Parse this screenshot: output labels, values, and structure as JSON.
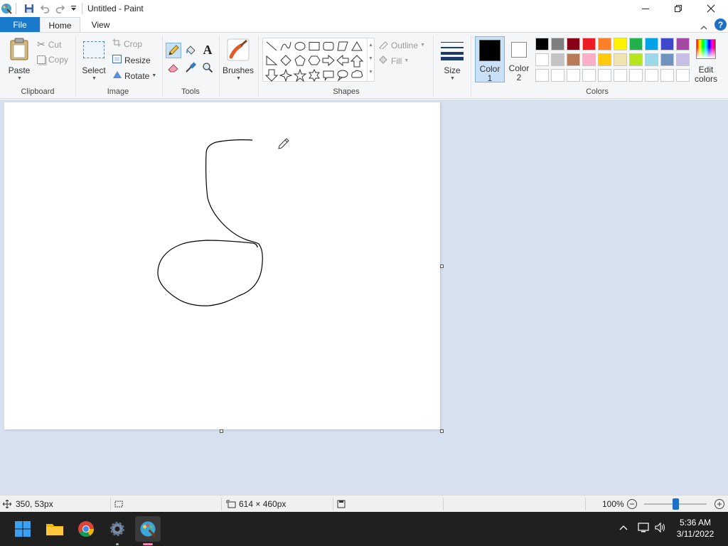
{
  "titlebar": {
    "title": "Untitled - Paint",
    "icons": [
      "paint-app-icon",
      "save-icon",
      "undo-icon",
      "redo-icon",
      "customize-quick-access-icon"
    ],
    "controls": [
      "minimize-icon",
      "maximize-icon",
      "close-icon"
    ]
  },
  "tabs": {
    "file": "File",
    "home": "Home",
    "view": "View"
  },
  "ribbon": {
    "clipboard": {
      "label": "Clipboard",
      "paste": "Paste",
      "cut": "Cut",
      "copy": "Copy"
    },
    "image": {
      "label": "Image",
      "select": "Select",
      "crop": "Crop",
      "resize": "Resize",
      "rotate": "Rotate"
    },
    "tools": {
      "label": "Tools",
      "items": [
        "pencil-icon",
        "fill-bucket-icon",
        "text-icon",
        "eraser-icon",
        "color-picker-icon",
        "magnifier-icon"
      ]
    },
    "brushes": {
      "label": "Brushes"
    },
    "shapes": {
      "label": "Shapes",
      "outline": "Outline",
      "fill": "Fill"
    },
    "size": {
      "label": "Size"
    },
    "color1": {
      "label": "Color",
      "num": "1",
      "color": "#000000"
    },
    "color2": {
      "label": "Color",
      "num": "2",
      "color": "#ffffff"
    },
    "colors": {
      "label": "Colors",
      "edit_label_1": "Edit",
      "edit_label_2": "colors",
      "row1": [
        "#000000",
        "#7f7f7f",
        "#880015",
        "#ed1c24",
        "#ff7f27",
        "#fff200",
        "#22b14c",
        "#00a2e8",
        "#3f48cc",
        "#a349a4"
      ],
      "row2": [
        "#ffffff",
        "#c3c3c3",
        "#b97a57",
        "#ffaec9",
        "#ffc90e",
        "#efe4b0",
        "#b5e61d",
        "#99d9ea",
        "#7092be",
        "#c8bfe7"
      ],
      "row3": [
        "#ffffff",
        "#ffffff",
        "#ffffff",
        "#ffffff",
        "#ffffff",
        "#ffffff",
        "#ffffff",
        "#ffffff",
        "#ffffff",
        "#ffffff"
      ]
    }
  },
  "statusbar": {
    "cursor_pos": "350, 53px",
    "canvas_size": "614 × 460px",
    "zoom": "100%",
    "zoom_fraction": 0.5
  },
  "taskbar": {
    "time": "5:36 AM",
    "date": "3/11/2022",
    "apps": [
      "windows-start-icon",
      "file-explorer-icon",
      "chrome-icon",
      "settings-icon",
      "paint-taskbar-icon"
    ]
  }
}
